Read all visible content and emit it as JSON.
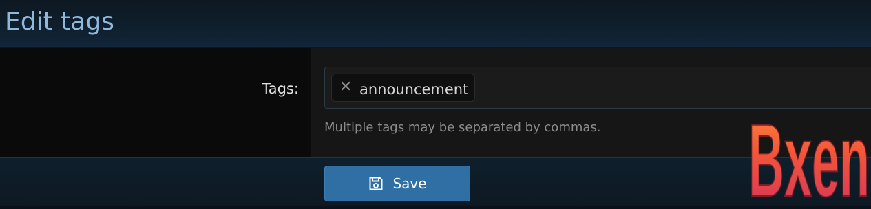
{
  "header": {
    "title": "Edit tags"
  },
  "form": {
    "tags_label": "Tags:",
    "tags": [
      {
        "label": "announcement"
      }
    ],
    "hint": "Multiple tags may be separated by commas."
  },
  "footer": {
    "save_label": "Save",
    "save_icon": "save-icon"
  },
  "watermark": {
    "text": "Bxen"
  },
  "colors": {
    "title": "#8fb8dd",
    "button": "#2f6fa3",
    "label_bg": "#0a0a0b",
    "input_bg": "#161616"
  }
}
